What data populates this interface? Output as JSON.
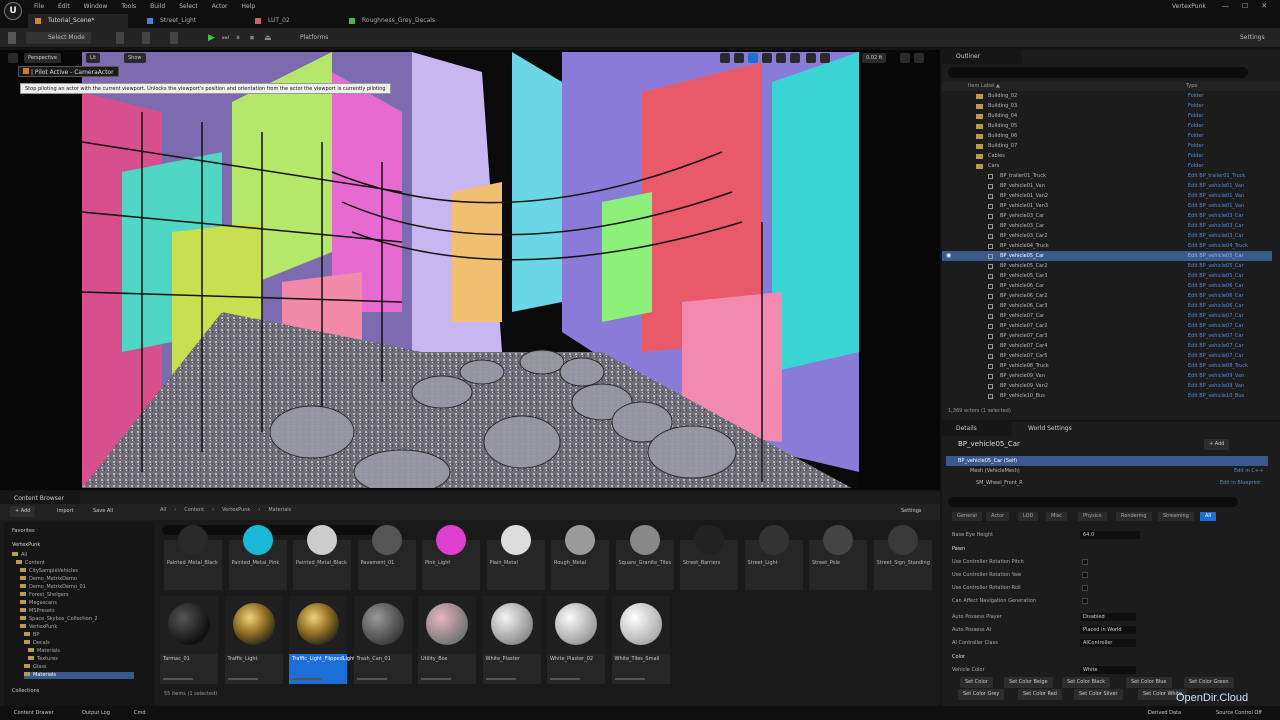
{
  "app": {
    "logo": "U",
    "name": "VertexPunk"
  },
  "menu": [
    "File",
    "Edit",
    "Window",
    "Tools",
    "Build",
    "Select",
    "Actor",
    "Help"
  ],
  "window_controls": [
    "—",
    "☐",
    "✕"
  ],
  "tabs": [
    {
      "label": "Tutorial_Scene*",
      "icon_color": "#d08a2c"
    },
    {
      "label": "Street_Light",
      "icon_color": "#3a8ad6"
    },
    {
      "label": "LUT_02",
      "icon_color": "#c86464"
    },
    {
      "label": "Roughness_Grey_Decals",
      "icon_color": "#4fae5a"
    }
  ],
  "toolbar": {
    "select_mode": "Select Mode",
    "platforms": "Platforms",
    "settings": "Settings"
  },
  "viewport": {
    "perspective": "Perspective",
    "lit": "Lit",
    "show": "Show",
    "pilot_label": "| Pilot Active - CameraActor",
    "tooltip": "Stop piloting an actor with the current viewport. Unlocks the viewport's position and orientation from the actor the viewport is currently piloting",
    "fps_label": "0.02 ft"
  },
  "outliner": {
    "title": "Outliner",
    "col_item": "Item Label ▲",
    "col_type": "Type",
    "status": "1,369 actors (1 selected)",
    "rows": [
      {
        "name": "Building_02",
        "type": "Folder",
        "folder": true
      },
      {
        "name": "Building_03",
        "type": "Folder",
        "folder": true
      },
      {
        "name": "Building_04",
        "type": "Folder",
        "folder": true
      },
      {
        "name": "Building_05",
        "type": "Folder",
        "folder": true
      },
      {
        "name": "Building_06",
        "type": "Folder",
        "folder": true
      },
      {
        "name": "Building_07",
        "type": "Folder",
        "folder": true
      },
      {
        "name": "Cables",
        "type": "Folder",
        "folder": true
      },
      {
        "name": "Cars",
        "type": "Folder",
        "folder": true
      },
      {
        "name": "BP_trailer01_Truck",
        "type": "Edit BP_trailer01_Truck"
      },
      {
        "name": "BP_vehicle01_Van",
        "type": "Edit BP_vehicle01_Van"
      },
      {
        "name": "BP_vehicle01_Van2",
        "type": "Edit BP_vehicle01_Van"
      },
      {
        "name": "BP_vehicle01_Van3",
        "type": "Edit BP_vehicle01_Van"
      },
      {
        "name": "BP_vehicle03_Car",
        "type": "Edit BP_vehicle03_Car"
      },
      {
        "name": "BP_vehicle03_Car",
        "type": "Edit BP_vehicle03_Car"
      },
      {
        "name": "BP_vehicle03_Car2",
        "type": "Edit BP_vehicle03_Car"
      },
      {
        "name": "BP_vehicle04_Truck",
        "type": "Edit BP_vehicle04_Truck"
      },
      {
        "name": "BP_vehicle05_Car",
        "type": "Edit BP_vehicle05_Car",
        "selected": true
      },
      {
        "name": "BP_vehicle05_Car2",
        "type": "Edit BP_vehicle05_Car"
      },
      {
        "name": "BP_vehicle05_Car3",
        "type": "Edit BP_vehicle05_Car"
      },
      {
        "name": "BP_vehicle06_Car",
        "type": "Edit BP_vehicle06_Car"
      },
      {
        "name": "BP_vehicle06_Car2",
        "type": "Edit BP_vehicle06_Car"
      },
      {
        "name": "BP_vehicle06_Car3",
        "type": "Edit BP_vehicle06_Car"
      },
      {
        "name": "BP_vehicle07_Car",
        "type": "Edit BP_vehicle07_Car"
      },
      {
        "name": "BP_vehicle07_Car2",
        "type": "Edit BP_vehicle07_Car"
      },
      {
        "name": "BP_vehicle07_Car3",
        "type": "Edit BP_vehicle07_Car"
      },
      {
        "name": "BP_vehicle07_Car4",
        "type": "Edit BP_vehicle07_Car"
      },
      {
        "name": "BP_vehicle07_Car5",
        "type": "Edit BP_vehicle07_Car"
      },
      {
        "name": "BP_vehicle08_Truck",
        "type": "Edit BP_vehicle08_Truck"
      },
      {
        "name": "BP_vehicle09_Van",
        "type": "Edit BP_vehicle09_Van"
      },
      {
        "name": "BP_vehicle09_Van2",
        "type": "Edit BP_vehicle09_Van"
      },
      {
        "name": "BP_vehicle10_Bus",
        "type": "Edit BP_vehicle10_Bus"
      }
    ]
  },
  "details": {
    "tab": "Details",
    "tab2": "World Settings",
    "actor": "BP_vehicle05_Car",
    "add": "+ Add",
    "self": "BP_vehicle05_Car (Self)",
    "mesh": "Mesh (VehicleMesh)",
    "edit_cpp": "Edit in C++",
    "wheel": "SM_Wheel_Front_R",
    "edit_bp": "Edit in Blueprint",
    "categories": [
      "General",
      "Actor",
      "LOD",
      "Misc",
      "Physics",
      "Rendering",
      "Streaming",
      "All"
    ],
    "base_eye": "Base Eye Height",
    "base_eye_val": "64.0",
    "pawn": "Pawn",
    "props": [
      "Use Controller Rotation Pitch",
      "Use Controller Rotation Yaw",
      "Use Controller Rotation Roll",
      "Can Affect Navigation Generation"
    ],
    "auto_possess": "Auto Possess Player",
    "auto_possess_val": "Disabled",
    "auto_possess_ai": "Auto Possess AI",
    "auto_possess_ai_val": "Placed in World",
    "ai_class": "AI Controller Class",
    "ai_class_val": "AIController",
    "color": "Color",
    "vehicle_color": "Vehicle Color",
    "vehicle_color_val": "White",
    "color_buttons": [
      "Set Color",
      "Set Color Beige",
      "Set Color Black",
      "Set Color Blue",
      "Set Color Green",
      "Set Color Grey",
      "Set Color Red",
      "Set Color Silver",
      "Set Color White"
    ]
  },
  "content_browser": {
    "title": "Content Browser",
    "add": "+ Add",
    "import": "Import",
    "save_all": "Save All",
    "path": [
      "All",
      "Content",
      "VertexPunk",
      "Materials"
    ],
    "settings": "Settings",
    "favorites": "Favorites",
    "root": "VertexPunk",
    "tree": [
      "All",
      "Content",
      "CitySampleVehicles",
      "Demo_MatrixDemo",
      "Demo_MatrixDemo_01",
      "Forest_Shelgers",
      "Megascans",
      "MSPresets",
      "Space_Skybox_Collection_2",
      "VertexPunk",
      "BP",
      "Decals",
      "Materials",
      "Textures",
      "Glass",
      "Materials"
    ],
    "collections": "Collections",
    "count": "55 items (1 selected)",
    "top_assets": [
      {
        "label": "Painted_Metal_Black",
        "color": "#2a2a2a"
      },
      {
        "label": "Painted_Metal_Pink",
        "color": "#1ab8d6"
      },
      {
        "label": "Painted_Metal_Black",
        "color": "#cccccc"
      },
      {
        "label": "Pavement_01",
        "color": "#555555"
      },
      {
        "label": "Pink_Light",
        "color": "#e040d0"
      },
      {
        "label": "Plain_Metal",
        "color": "#dddddd"
      },
      {
        "label": "Rough_Metal",
        "color": "#9a9a9a"
      },
      {
        "label": "Square_Granite_Tiles",
        "color": "#888888"
      },
      {
        "label": "Street_Barriers",
        "color": "#222222"
      },
      {
        "label": "Street_Light",
        "color": "#333333"
      },
      {
        "label": "Street_Pole",
        "color": "#444444"
      },
      {
        "label": "Street_Sign_Standing",
        "color": "#3a3a3a"
      }
    ],
    "assets": [
      {
        "label": "Tarmac_01",
        "style": "radial-gradient(circle at 35% 35%,#555,#111 70%)"
      },
      {
        "label": "Traffic_Light",
        "style": "radial-gradient(circle at 40% 35%,#f2d27a,#8a6a20 45%,#222 80%)"
      },
      {
        "label": "Traffic_Light_FlippedLights",
        "style": "radial-gradient(circle at 40% 35%,#f2d27a,#8a6a20 45%,#222 80%)",
        "selected": true
      },
      {
        "label": "Trash_Can_01",
        "style": "radial-gradient(circle at 35% 35%,#999,#3a3a3a 75%)"
      },
      {
        "label": "Utility_Box",
        "style": "radial-gradient(circle at 35% 35%,#e6b6c0,#777 70%)"
      },
      {
        "label": "White_Plaster",
        "style": "radial-gradient(circle at 35% 35%,#f4f4f4,#8a8a8a 75%)"
      },
      {
        "label": "White_Plaster_02",
        "style": "radial-gradient(circle at 35% 35%,#fafafa,#999 75%)"
      },
      {
        "label": "White_Tiles_Small",
        "style": "radial-gradient(circle at 35% 35%,#ffffff,#aaaaaa 75%)"
      }
    ]
  },
  "statusbar": {
    "content_drawer": "Content Drawer",
    "output_log": "Output Log",
    "cmd": "Cmd",
    "derived": "Derived Data",
    "source": "Source Control Off"
  },
  "watermark": "OpenDir.Cloud"
}
